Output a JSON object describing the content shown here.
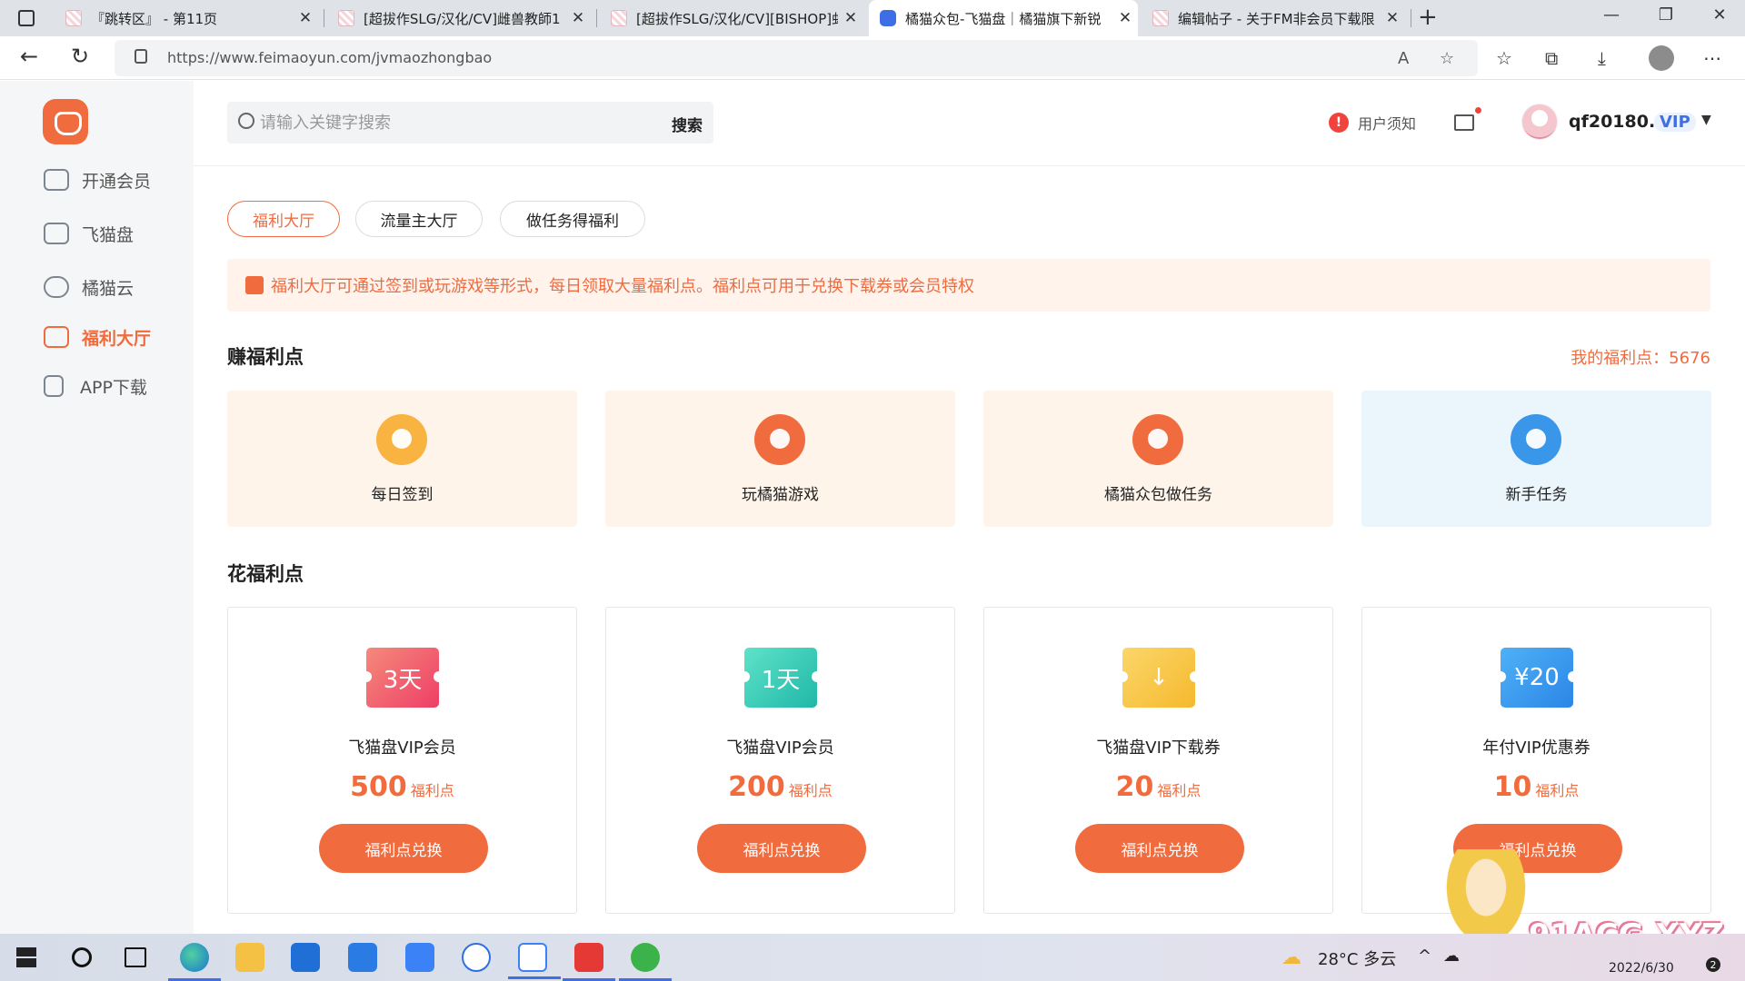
{
  "browser": {
    "tabs": [
      {
        "title": "『跳转区』 - 第11页",
        "active": false
      },
      {
        "title": "[超拔作SLG/汉化/CV]雌兽教師1",
        "active": false
      },
      {
        "title": "[超拔作SLG/汉化/CV][BISHOP]虬",
        "active": false
      },
      {
        "title": "橘猫众包-飞猫盘｜橘猫旗下新锐",
        "active": true
      },
      {
        "title": "编辑帖子 - 关于FM非会员下载限",
        "active": false
      }
    ],
    "new_tab_label": "+",
    "url": "https://www.feimaoyun.com/jvmaozhongbao"
  },
  "sidebar": {
    "items": [
      {
        "label": "开通会员",
        "icon": "crown-icon"
      },
      {
        "label": "飞猫盘",
        "icon": "cat-icon"
      },
      {
        "label": "橘猫云",
        "icon": "cloud-icon"
      },
      {
        "label": "福利大厅",
        "icon": "gift-icon",
        "active": true
      },
      {
        "label": "APP下载",
        "icon": "download-box-icon"
      }
    ]
  },
  "header": {
    "search_placeholder": "请输入关键字搜索",
    "search_button": "搜索",
    "notice": "用户须知",
    "username": "qf20180...",
    "vip": "VIP"
  },
  "tabs": [
    {
      "label": "福利大厅",
      "active": true
    },
    {
      "label": "流量主大厅",
      "active": false
    },
    {
      "label": "做任务得福利",
      "active": false
    }
  ],
  "banner_text": "福利大厅可通过签到或玩游戏等形式，每日领取大量福利点。福利点可用于兑换下载券或会员特权",
  "earn": {
    "title": "赚福利点",
    "points_label": "我的福利点：5676",
    "cards": [
      {
        "label": "每日签到",
        "color": "#f8b340",
        "bg": "#fff4ea"
      },
      {
        "label": "玩橘猫游戏",
        "color": "#f06b3e",
        "bg": "#fff4ea"
      },
      {
        "label": "橘猫众包做任务",
        "color": "#f06b3e",
        "bg": "#fff4ea"
      },
      {
        "label": "新手任务",
        "color": "#3a96e8",
        "bg": "#eaf5fc"
      }
    ]
  },
  "spend": {
    "title": "花福利点",
    "unit": "福利点",
    "button": "福利点兑换",
    "cards": [
      {
        "ticket": "3天",
        "name": "飞猫盘VIP会员",
        "cost": "500",
        "color": "#f2566a"
      },
      {
        "ticket": "1天",
        "name": "飞猫盘VIP会员",
        "cost": "200",
        "color": "#33c7b2"
      },
      {
        "ticket": "↓",
        "name": "飞猫盘VIP下载券",
        "cost": "20",
        "color": "#f7c444"
      },
      {
        "ticket": "¥20",
        "name": "年付VIP优惠券",
        "cost": "10",
        "color": "#3196ef"
      }
    ]
  },
  "watermark": "91ACG.XYZ",
  "taskbar": {
    "weather": "28°C 多云",
    "date": "2022/6/30",
    "notification_count": "2"
  }
}
